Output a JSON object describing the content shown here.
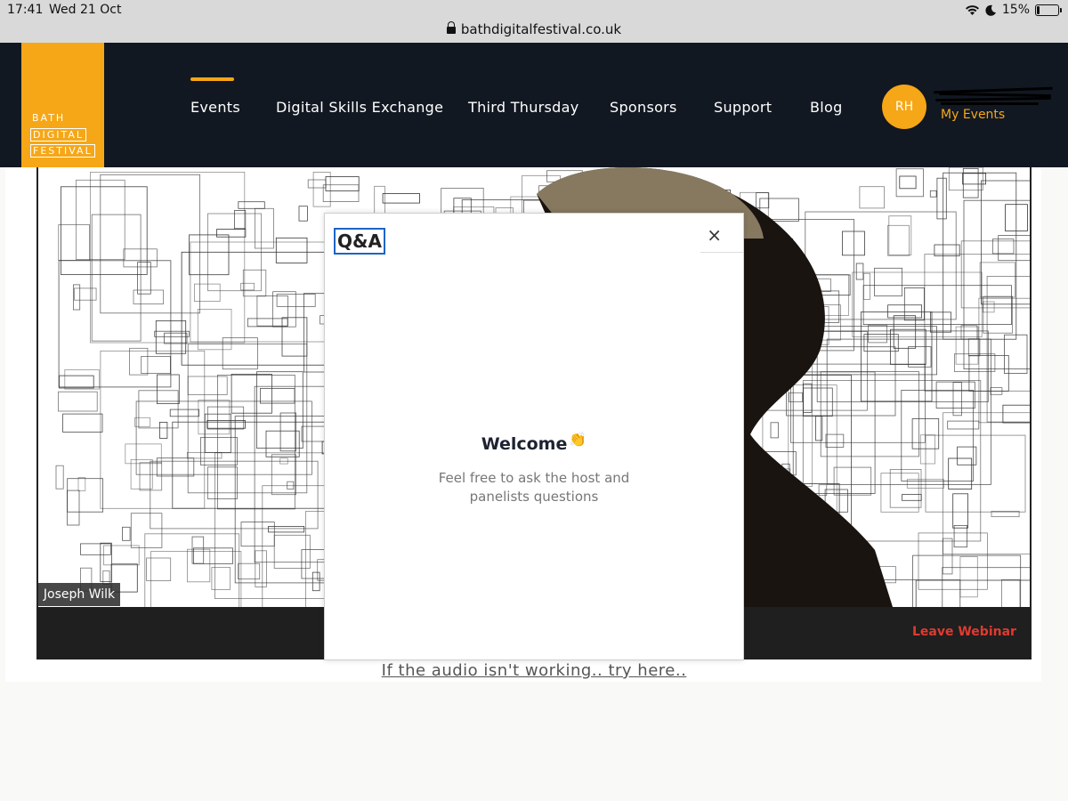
{
  "status_bar": {
    "time": "17:41",
    "date": "Wed 21 Oct",
    "battery_percent": "15%",
    "battery_level": 0.15
  },
  "browser": {
    "url": "bathdigitalfestival.co.uk"
  },
  "header": {
    "logo_lines": [
      "BATH",
      "DIGITAL",
      "FESTIVAL"
    ],
    "nav": {
      "events": "Events",
      "skills": "Digital Skills Exchange",
      "third_thursday": "Third Thursday",
      "sponsors": "Sponsors",
      "support": "Support",
      "blog": "Blog"
    },
    "active_nav": "Events",
    "user_initials": "RH",
    "my_events": "My Events"
  },
  "webinar": {
    "speaker_name": "Joseph Wilk",
    "leave_label": "Leave Webinar"
  },
  "qa_panel": {
    "title": "Q&A",
    "close_icon": "×",
    "welcome_title": "Welcome",
    "welcome_emoji": "👏",
    "welcome_subtitle": "Feel free to ask the host and panelists questions"
  },
  "audio_link": "If the audio isn't working.. try here..",
  "colors": {
    "accent": "#f6a717",
    "header_bg": "#121822",
    "leave": "#e03a2f",
    "focus": "#1c65c6"
  }
}
